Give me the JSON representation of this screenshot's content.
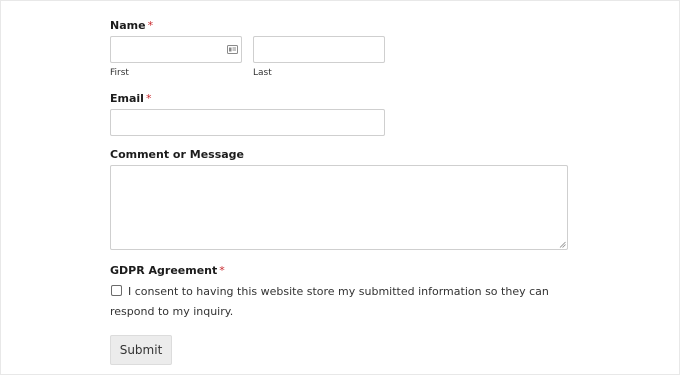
{
  "form": {
    "name": {
      "label": "Name",
      "required_mark": "*",
      "first_sublabel": "First",
      "last_sublabel": "Last",
      "first_value": "",
      "last_value": ""
    },
    "email": {
      "label": "Email",
      "required_mark": "*",
      "value": ""
    },
    "comment": {
      "label": "Comment or Message",
      "value": ""
    },
    "gdpr": {
      "label": "GDPR Agreement",
      "required_mark": "*",
      "consent_text": "I consent to having this website store my submitted information so they can respond to my inquiry.",
      "checked": false
    },
    "submit_label": "Submit"
  },
  "colors": {
    "required": "#c9282d",
    "border": "#cfcfcf",
    "button_bg": "#ececec"
  },
  "icons": {
    "name_field_icon": "contact-card-icon",
    "textarea_handle": "resize-handle-icon",
    "consent": "checkbox-icon"
  }
}
